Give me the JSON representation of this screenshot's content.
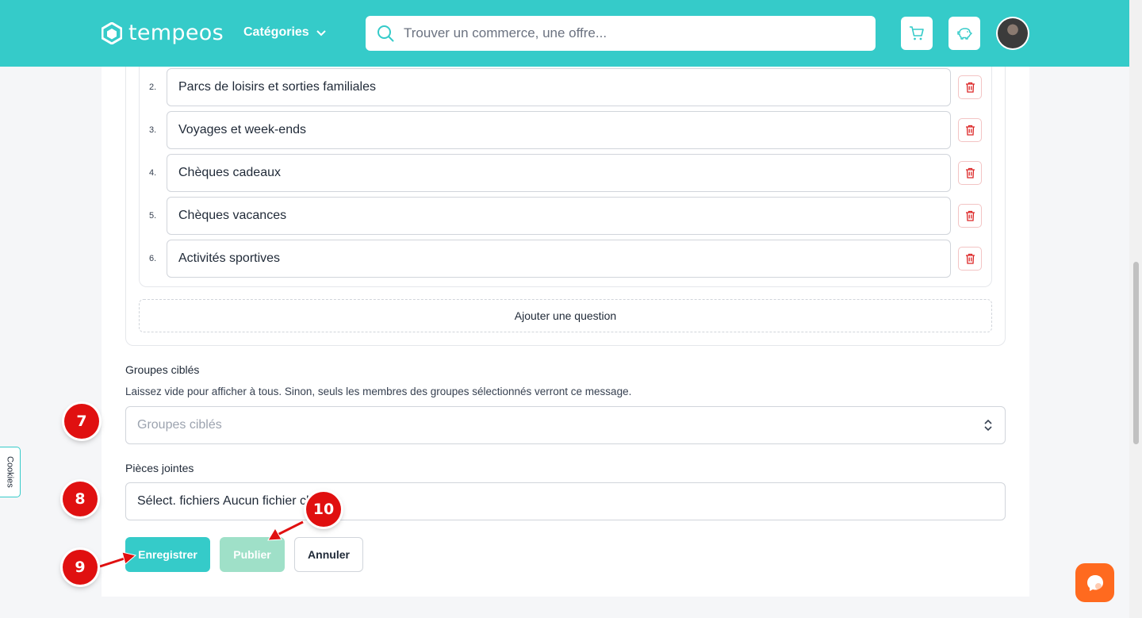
{
  "header": {
    "brand": "tempeos",
    "categories_label": "Catégories",
    "search_placeholder": "Trouver un commerce, une offre...",
    "colors": {
      "header_bg": "#35cbc9"
    }
  },
  "options": [
    {
      "number": "2.",
      "value": "Parcs de loisirs et sorties familiales"
    },
    {
      "number": "3.",
      "value": "Voyages et week-ends"
    },
    {
      "number": "4.",
      "value": "Chèques cadeaux"
    },
    {
      "number": "5.",
      "value": "Chèques vacances"
    },
    {
      "number": "6.",
      "value": "Activités sportives"
    }
  ],
  "add_question_label": "Ajouter une question",
  "target_groups": {
    "label": "Groupes ciblés",
    "help": "Laissez vide pour afficher à tous. Sinon, seuls les membres des groupes sélectionnés verront ce message.",
    "placeholder": "Groupes ciblés"
  },
  "attachments": {
    "label": "Pièces jointes",
    "button_label": "Sélect. fichiers",
    "status": "Aucun fichier choisi"
  },
  "actions": {
    "save": "Enregistrer",
    "publish": "Publier",
    "cancel": "Annuler"
  },
  "markers": [
    "7",
    "8",
    "9",
    "10"
  ],
  "cookies_label": "Cookies",
  "colors": {
    "accent": "#35cbc9",
    "publish_disabled": "#9fe0c8",
    "marker": "#e01010",
    "chat": "#ff6a1f",
    "delete": "#dc2626"
  }
}
